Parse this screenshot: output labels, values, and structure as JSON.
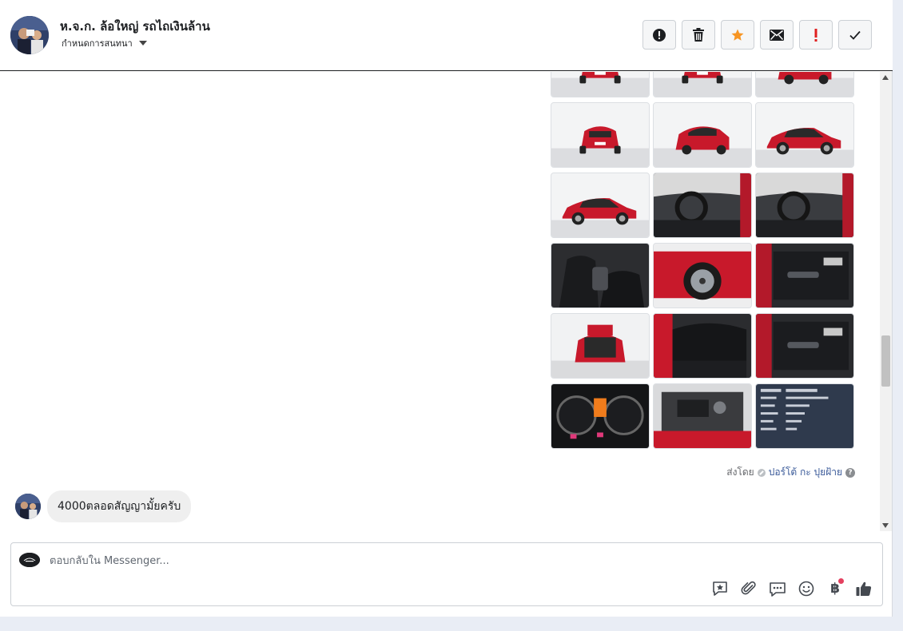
{
  "header": {
    "title": "ห.จ.ก. ล้อใหญ่ รถไถเงินล้าน",
    "subtitle": "กำหนดการสนทนา"
  },
  "toolbar": {
    "buttons": [
      {
        "name": "report-button",
        "icon": "exclamation-circle-icon"
      },
      {
        "name": "delete-button",
        "icon": "trash-icon"
      },
      {
        "name": "star-button",
        "icon": "star-icon",
        "color": "#f79523"
      },
      {
        "name": "mark-unread-button",
        "icon": "envelope-icon"
      },
      {
        "name": "priority-button",
        "icon": "exclamation-icon",
        "color": "#e02020"
      },
      {
        "name": "done-button",
        "icon": "check-icon"
      }
    ]
  },
  "attachment_photos": [
    {
      "type": "car-rear"
    },
    {
      "type": "car-rear"
    },
    {
      "type": "car-rear-3q"
    },
    {
      "type": "car-rear"
    },
    {
      "type": "car-rear-3q"
    },
    {
      "type": "car-side"
    },
    {
      "type": "car-side"
    },
    {
      "type": "interior-dash"
    },
    {
      "type": "interior-dash"
    },
    {
      "type": "interior-seat"
    },
    {
      "type": "wheel"
    },
    {
      "type": "interior-door"
    },
    {
      "type": "trunk-open"
    },
    {
      "type": "interior-rear-seat"
    },
    {
      "type": "interior-door"
    },
    {
      "type": "gauge"
    },
    {
      "type": "engine"
    },
    {
      "type": "spec-sheet"
    }
  ],
  "sent_by": {
    "prefix": "ส่งโดย",
    "name": "ปอร์โต้ กะ ปุยฝ้าย",
    "help": "?"
  },
  "message": {
    "text": "4000ตลอดสัญญามั้ยครับ"
  },
  "composer": {
    "placeholder": "ตอบกลับใน Messenger...",
    "currency_symbol": "฿"
  },
  "colors": {
    "accent_star": "#f79523",
    "priority_red": "#e02020",
    "link_blue": "#385898"
  }
}
